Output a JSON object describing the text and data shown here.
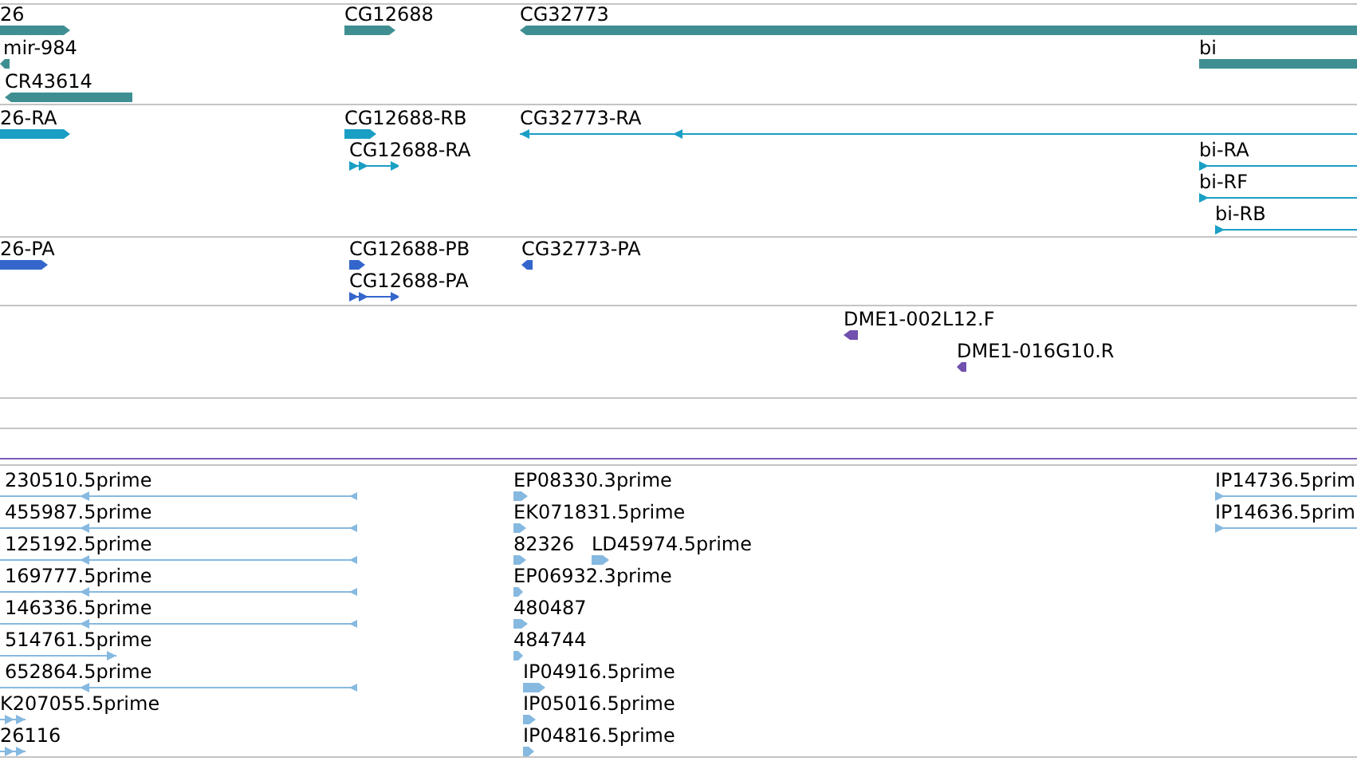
{
  "tracks": [
    {
      "kind": "gene",
      "features": [
        {
          "label": "26",
          "reverse": false
        },
        {
          "label": "mir-984",
          "reverse": true
        },
        {
          "label": "CR43614",
          "reverse": true
        },
        {
          "label": "CG12688",
          "reverse": false
        },
        {
          "label": "CG32773",
          "reverse": true
        },
        {
          "label": "bi",
          "reverse": false
        }
      ]
    },
    {
      "kind": "transcript",
      "features": [
        {
          "label": "26-RA",
          "reverse": false
        },
        {
          "label": "CG12688-RB",
          "reverse": false
        },
        {
          "label": "CG12688-RA",
          "reverse": false
        },
        {
          "label": "CG32773-RA",
          "reverse": true
        },
        {
          "label": "bi-RA",
          "reverse": false
        },
        {
          "label": "bi-RF",
          "reverse": false
        },
        {
          "label": "bi-RB",
          "reverse": false
        }
      ]
    },
    {
      "kind": "protein",
      "features": [
        {
          "label": "26-PA",
          "reverse": false
        },
        {
          "label": "CG12688-PB",
          "reverse": false
        },
        {
          "label": "CG12688-PA",
          "reverse": false
        },
        {
          "label": "CG32773-PA",
          "reverse": true
        }
      ]
    },
    {
      "kind": "clone_end",
      "features": [
        {
          "label": "DME1-002L12.F",
          "reverse": true
        },
        {
          "label": "DME1-016G10.R",
          "reverse": true
        }
      ]
    },
    {
      "kind": "est",
      "features": [
        {
          "label": "230510.5prime",
          "reverse": true
        },
        {
          "label": "EP08330.3prime",
          "reverse": false
        },
        {
          "label": "IP14736.5prim",
          "reverse": false
        },
        {
          "label": "455987.5prime",
          "reverse": true
        },
        {
          "label": "EK071831.5prime",
          "reverse": false
        },
        {
          "label": "IP14636.5prim",
          "reverse": false
        },
        {
          "label": "125192.5prime",
          "reverse": true
        },
        {
          "label": "82326",
          "reverse": false
        },
        {
          "label": "LD45974.5prime",
          "reverse": false
        },
        {
          "label": "169777.5prime",
          "reverse": true
        },
        {
          "label": "EP06932.3prime",
          "reverse": false
        },
        {
          "label": "146336.5prime",
          "reverse": true
        },
        {
          "label": "480487",
          "reverse": false
        },
        {
          "label": "514761.5prime",
          "reverse": false
        },
        {
          "label": "484744",
          "reverse": false
        },
        {
          "label": "652864.5prime",
          "reverse": true
        },
        {
          "label": "IP04916.5prime",
          "reverse": false
        },
        {
          "label": "K207055.5prime",
          "reverse": false
        },
        {
          "label": "IP05016.5prime",
          "reverse": false
        },
        {
          "label": "26116",
          "reverse": false
        },
        {
          "label": "IP04816.5prime",
          "reverse": false
        }
      ]
    }
  ]
}
